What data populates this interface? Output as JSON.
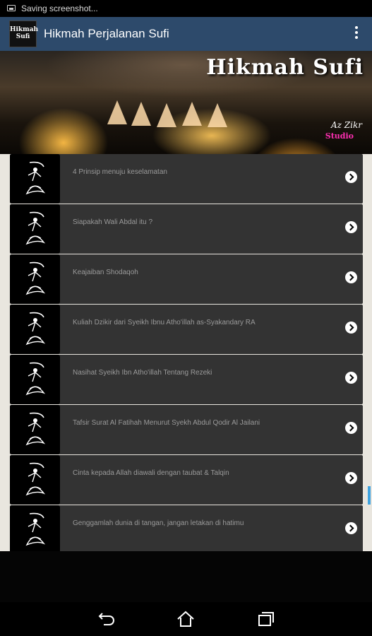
{
  "status_bar": {
    "notification": "Saving screenshot..."
  },
  "app_bar": {
    "icon_text": [
      "Hikmah",
      "Sufi"
    ],
    "title": "Hikmah Perjalanan Sufi",
    "menu_icon": "overflow-menu-icon"
  },
  "banner": {
    "title": "Hikmah Sufi",
    "credit_line1": "Az Zikr",
    "credit_line2": "Studio"
  },
  "list": {
    "items": [
      {
        "label": "4 Prinsip menuju keselamatan"
      },
      {
        "label": "Siapakah Wali Abdal itu ?"
      },
      {
        "label": "Keajaiban Shodaqoh"
      },
      {
        "label": "Kuliah Dzikir dari Syeikh Ibnu Atho'illah as-Syakandary RA"
      },
      {
        "label": "Nasihat Syeikh Ibn Atho'illah Tentang Rezeki"
      },
      {
        "label": "Tafsir Surat Al Fatihah Menurut Syekh Abdul Qodir Al Jailani"
      },
      {
        "label": "Cinta kepada Allah diawali dengan taubat & Talqin"
      },
      {
        "label": "Genggamlah dunia di tangan, jangan letakan di hatimu"
      }
    ]
  },
  "nav_bar": {
    "back_icon": "back-icon",
    "home_icon": "home-icon",
    "recents_icon": "recents-icon"
  },
  "colors": {
    "action_bar": "#2d4a6b",
    "list_item": "#333333",
    "scroll_indicator": "#3fa3e0",
    "credit_accent": "#ff2fb2"
  }
}
